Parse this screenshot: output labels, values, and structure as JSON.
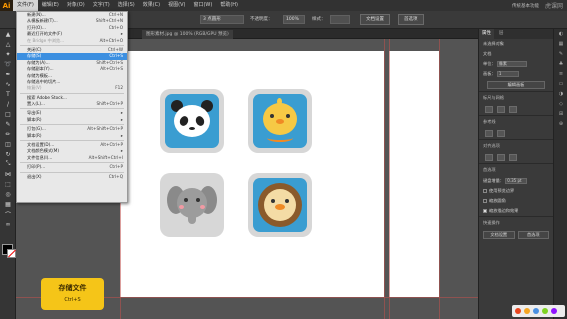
{
  "app": {
    "logo": "Ai",
    "workspace": "传统基本功能",
    "watermark": "虎课网"
  },
  "menubar": [
    "文件(F)",
    "编辑(E)",
    "对象(O)",
    "文字(T)",
    "选择(S)",
    "效果(C)",
    "视图(V)",
    "窗口(W)",
    "帮助(H)"
  ],
  "control_bar": {
    "stroke_style": "3 点圆形",
    "opacity_label": "不透明度：",
    "opacity_value": "100%",
    "style_label": "样式：",
    "doc_setup_btn": "文档设置",
    "prefs_btn": "首选项"
  },
  "doc_tab": "图形素材.jpg @ 100% (RGB/GPU 预览)",
  "file_menu": [
    {
      "label": "新建(N)...",
      "shortcut": "Ctrl+N"
    },
    {
      "label": "从模板新建(T)...",
      "shortcut": "Shift+Ctrl+N"
    },
    {
      "label": "打开(O)...",
      "shortcut": "Ctrl+O"
    },
    {
      "label": "最近打开的文件(F)",
      "shortcut": "▸"
    },
    {
      "label": "在 Bridge 中浏览...",
      "shortcut": "Alt+Ctrl+O",
      "disabled": true
    },
    {
      "sep": true
    },
    {
      "label": "关闭(C)",
      "shortcut": "Ctrl+W"
    },
    {
      "label": "存储(S)",
      "shortcut": "Ctrl+S",
      "highlight": true
    },
    {
      "label": "存储为(A)...",
      "shortcut": "Shift+Ctrl+S"
    },
    {
      "label": "存储副本(Y)...",
      "shortcut": "Alt+Ctrl+S"
    },
    {
      "label": "存储为模板...",
      "shortcut": ""
    },
    {
      "label": "存储选中的切片...",
      "shortcut": ""
    },
    {
      "label": "恢复(V)",
      "shortcut": "F12",
      "disabled": true
    },
    {
      "sep": true
    },
    {
      "label": "搜索 Adobe Stock...",
      "shortcut": ""
    },
    {
      "label": "置入(L)...",
      "shortcut": "Shift+Ctrl+P"
    },
    {
      "sep": true
    },
    {
      "label": "导出(E)",
      "shortcut": "▸"
    },
    {
      "label": "脚本(R)",
      "shortcut": "▸"
    },
    {
      "sep": true
    },
    {
      "label": "打包(G)...",
      "shortcut": "Alt+Shift+Ctrl+P"
    },
    {
      "label": "脚本(R)",
      "shortcut": "▸"
    },
    {
      "sep": true
    },
    {
      "label": "文档设置(D)...",
      "shortcut": "Alt+Ctrl+P"
    },
    {
      "label": "文档颜色模式(M)",
      "shortcut": "▸"
    },
    {
      "label": "文件信息(I)...",
      "shortcut": "Alt+Shift+Ctrl+I"
    },
    {
      "sep": true
    },
    {
      "label": "打印(P)...",
      "shortcut": "Ctrl+P"
    },
    {
      "sep": true
    },
    {
      "label": "退出(X)",
      "shortcut": "Ctrl+Q"
    }
  ],
  "panel": {
    "tabs": [
      "属性",
      "层"
    ],
    "section_no_selection": "未选择对象",
    "doc_label": "文档",
    "unit_label": "单位：",
    "unit_value": "像素",
    "artboard_label": "画板：",
    "artboard_value": "1",
    "edit_artboard_btn": "编辑画板",
    "ruler_grid": "标尺与网格",
    "guides": "参考线",
    "snap": "对齐选项",
    "prefs": "首选项",
    "keyboard_increment": "键盘增量：",
    "increment_value": "0.35 pt",
    "cb1": "使用预览边界",
    "cb2": "缩放圆角",
    "cb3": "缩放描边和效果",
    "quick_actions": "快速操作",
    "doc_setup_btn": "文档设置",
    "prefs_btn": "首选项"
  },
  "badge": {
    "title": "存储文件",
    "shortcut": "Ctrl+S"
  }
}
